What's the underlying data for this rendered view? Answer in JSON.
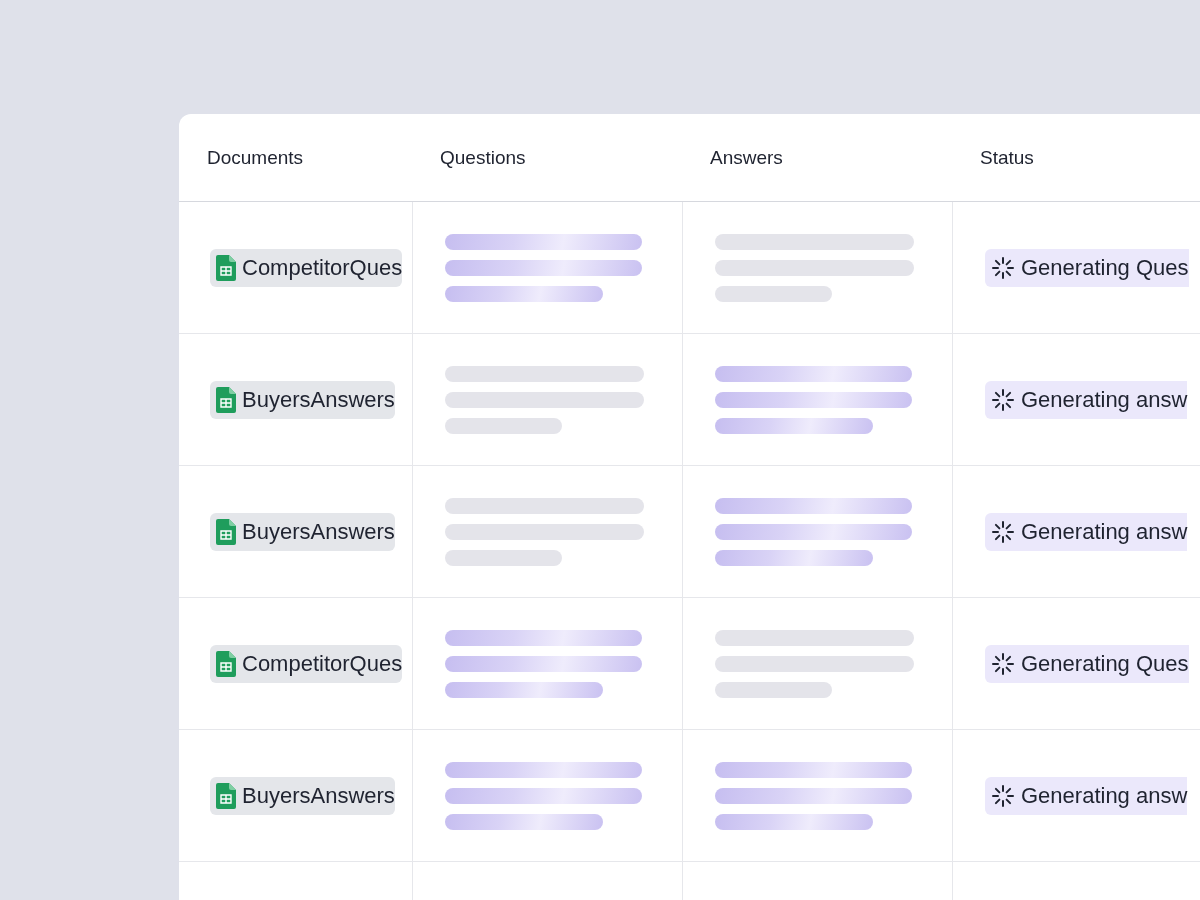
{
  "table": {
    "columns": [
      "Documents",
      "Questions",
      "Answers",
      "Status"
    ],
    "rows": [
      {
        "document": "CompetitorQues",
        "questions_generating": true,
        "answers_generating": false,
        "status": "Generating Ques"
      },
      {
        "document": "BuyersAnswers",
        "questions_generating": false,
        "answers_generating": true,
        "status": "Generating answ"
      },
      {
        "document": "BuyersAnswers",
        "questions_generating": false,
        "answers_generating": true,
        "status": "Generating answ"
      },
      {
        "document": "CompetitorQues",
        "questions_generating": true,
        "answers_generating": false,
        "status": "Generating Ques"
      },
      {
        "document": "BuyersAnswers",
        "questions_generating": true,
        "answers_generating": true,
        "status": "Generating answ"
      }
    ]
  }
}
